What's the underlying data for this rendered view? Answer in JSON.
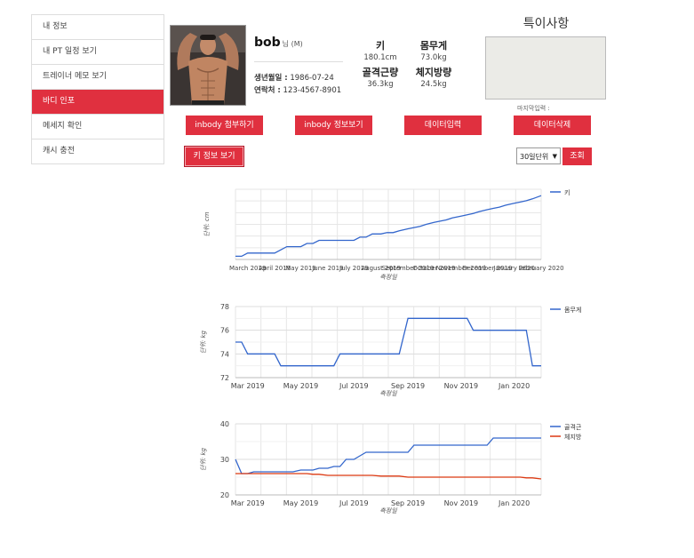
{
  "sidebar": {
    "items": [
      {
        "label": "내 정보"
      },
      {
        "label": "내 PT 일정 보기"
      },
      {
        "label": "트레이너 메모 보기"
      },
      {
        "label": "바디 인포"
      },
      {
        "label": "메세지 확인"
      },
      {
        "label": "캐시 충전"
      }
    ]
  },
  "profile": {
    "name": "bob",
    "suffix": "님 (M)",
    "birth_label": "생년월일 :",
    "birth": "1986-07-24",
    "contact_label": "연락처 :",
    "contact": "123-4567-8901"
  },
  "stats": {
    "height_label": "키",
    "height_value": "180.1cm",
    "weight_label": "몸무게",
    "weight_value": "73.0kg",
    "muscle_label": "골격근량",
    "muscle_value": "36.3kg",
    "fat_label": "체지방량",
    "fat_value": "24.5kg"
  },
  "notes": {
    "title": "특이사항",
    "last_input": "마지막입력 :"
  },
  "buttons": {
    "inbody_attach": "inbody 첨부하기",
    "inbody_view": "inbody 정보보기",
    "data_input": "데이터입력",
    "data_delete": "데이터삭제",
    "height_view": "키 정보 보기",
    "search": "조회"
  },
  "period_select": {
    "value": "30일단위"
  },
  "colors": {
    "accent": "#e0303f",
    "series_blue": "#3366cc",
    "series_red": "#dc3912"
  },
  "chart_data": [
    {
      "type": "line",
      "xlabel": "측정일",
      "ylabel": "단위: cm",
      "x_ticks": [
        "March 2019",
        "April 2019",
        "May 2019",
        "June 2019",
        "July 2019",
        "August 2019",
        "September 2019",
        "October 2019",
        "November 2019",
        "December 2019",
        "January 2020",
        "February 2020"
      ],
      "x": [
        "2019-02-15",
        "2019-02-22",
        "2019-03-01",
        "2019-03-08",
        "2019-03-15",
        "2019-03-22",
        "2019-04-01",
        "2019-04-08",
        "2019-04-15",
        "2019-04-22",
        "2019-05-01",
        "2019-05-08",
        "2019-05-15",
        "2019-05-22",
        "2019-06-01",
        "2019-06-08",
        "2019-06-15",
        "2019-06-22",
        "2019-07-01",
        "2019-07-08",
        "2019-07-15",
        "2019-07-22",
        "2019-08-01",
        "2019-08-08",
        "2019-08-15",
        "2019-08-22",
        "2019-09-01",
        "2019-09-08",
        "2019-09-15",
        "2019-09-22",
        "2019-10-01",
        "2019-10-08",
        "2019-10-15",
        "2019-10-22",
        "2019-11-01",
        "2019-11-08",
        "2019-11-15",
        "2019-11-22",
        "2019-12-01",
        "2019-12-08",
        "2019-12-15",
        "2019-12-22",
        "2020-01-01",
        "2020-01-08",
        "2020-01-15",
        "2020-01-22",
        "2020-02-01"
      ],
      "series": [
        {
          "name": "키",
          "values": [
            165.5,
            165.5,
            166,
            166,
            166,
            166,
            166,
            166.5,
            167,
            167,
            167,
            167.5,
            167.5,
            168,
            168,
            168,
            168,
            168,
            168,
            168.5,
            168.5,
            169,
            169,
            169.2,
            169.2,
            169.5,
            169.8,
            170,
            170.2,
            170.5,
            170.8,
            171,
            171.2,
            171.5,
            171.8,
            172,
            172.2,
            172.5,
            172.8,
            173,
            173.2,
            173.5,
            173.8,
            174,
            174.2,
            174.5,
            175
          ]
        }
      ],
      "grid": true,
      "legend": "top-right"
    },
    {
      "type": "line",
      "xlabel": "측정일",
      "ylabel": "단위: kg",
      "x_ticks": [
        "Mar 2019",
        "May 2019",
        "Jul 2019",
        "Sep 2019",
        "Nov 2019",
        "Jan 2020"
      ],
      "y_ticks": [
        72,
        74,
        76,
        78
      ],
      "ylim": [
        72,
        78
      ],
      "x": [
        "2019-02-15",
        "2019-02-22",
        "2019-03-01",
        "2019-03-08",
        "2019-03-15",
        "2019-03-22",
        "2019-04-01",
        "2019-04-08",
        "2019-04-15",
        "2019-04-22",
        "2019-05-01",
        "2019-05-08",
        "2019-05-15",
        "2019-05-22",
        "2019-06-01",
        "2019-06-08",
        "2019-06-15",
        "2019-06-22",
        "2019-07-01",
        "2019-07-08",
        "2019-07-15",
        "2019-07-22",
        "2019-08-01",
        "2019-08-08",
        "2019-08-15",
        "2019-08-22",
        "2019-09-01",
        "2019-09-08",
        "2019-09-15",
        "2019-09-22",
        "2019-10-01",
        "2019-10-08",
        "2019-10-15",
        "2019-10-22",
        "2019-11-01",
        "2019-11-08",
        "2019-11-15",
        "2019-11-22",
        "2019-12-01",
        "2019-12-08",
        "2019-12-15",
        "2019-12-22",
        "2020-01-01",
        "2020-01-08",
        "2020-01-15",
        "2020-01-22",
        "2020-02-01"
      ],
      "series": [
        {
          "name": "몸무게",
          "values": [
            75,
            75,
            74,
            74,
            74,
            74,
            74,
            73,
            73,
            73,
            73,
            73,
            73,
            73,
            73,
            73,
            74,
            74,
            74,
            74,
            74,
            74,
            74,
            74,
            74,
            74,
            77,
            77,
            77,
            77,
            77,
            77,
            77,
            77,
            77,
            77,
            76,
            76,
            76,
            76,
            76,
            76,
            76,
            76,
            76,
            73,
            73
          ]
        }
      ],
      "grid": true,
      "legend": "top-right"
    },
    {
      "type": "line",
      "xlabel": "측정일",
      "ylabel": "단위: kg",
      "x_ticks": [
        "Mar 2019",
        "May 2019",
        "Jul 2019",
        "Sep 2019",
        "Nov 2019",
        "Jan 2020"
      ],
      "y_ticks": [
        20,
        30,
        40
      ],
      "ylim": [
        20,
        40
      ],
      "x": [
        "2019-02-15",
        "2019-02-22",
        "2019-03-01",
        "2019-03-08",
        "2019-03-15",
        "2019-03-22",
        "2019-04-01",
        "2019-04-08",
        "2019-04-15",
        "2019-04-22",
        "2019-05-01",
        "2019-05-08",
        "2019-05-15",
        "2019-05-22",
        "2019-06-01",
        "2019-06-08",
        "2019-06-15",
        "2019-06-22",
        "2019-07-01",
        "2019-07-08",
        "2019-07-15",
        "2019-07-22",
        "2019-08-01",
        "2019-08-08",
        "2019-08-15",
        "2019-08-22",
        "2019-09-01",
        "2019-09-08",
        "2019-09-15",
        "2019-09-22",
        "2019-10-01",
        "2019-10-08",
        "2019-10-15",
        "2019-10-22",
        "2019-11-01",
        "2019-11-08",
        "2019-11-15",
        "2019-11-22",
        "2019-12-01",
        "2019-12-08",
        "2019-12-15",
        "2019-12-22",
        "2020-01-01",
        "2020-01-08",
        "2020-01-15",
        "2020-01-22",
        "2020-02-01"
      ],
      "series": [
        {
          "name": "골격근",
          "values": [
            30,
            26,
            26,
            26.5,
            26.5,
            26.5,
            26.5,
            26.5,
            26.5,
            26.5,
            27,
            27,
            27,
            27.5,
            27.5,
            28,
            28,
            30,
            30,
            31,
            32,
            32,
            32,
            32,
            32,
            32,
            32,
            34,
            34,
            34,
            34,
            34,
            34,
            34,
            34,
            34,
            34,
            34,
            34,
            36,
            36,
            36,
            36,
            36,
            36,
            36,
            36
          ]
        },
        {
          "name": "체지방",
          "values": [
            26,
            26,
            26,
            26,
            26,
            26,
            26,
            26,
            26,
            26,
            26,
            26,
            25.8,
            25.8,
            25.5,
            25.5,
            25.5,
            25.5,
            25.5,
            25.5,
            25.5,
            25.5,
            25.3,
            25.3,
            25.3,
            25.3,
            25,
            25,
            25,
            25,
            25,
            25,
            25,
            25,
            25,
            25,
            25,
            25,
            25,
            25,
            25,
            25,
            25,
            25,
            24.8,
            24.8,
            24.5
          ]
        }
      ],
      "grid": true,
      "legend": "top-right"
    }
  ]
}
